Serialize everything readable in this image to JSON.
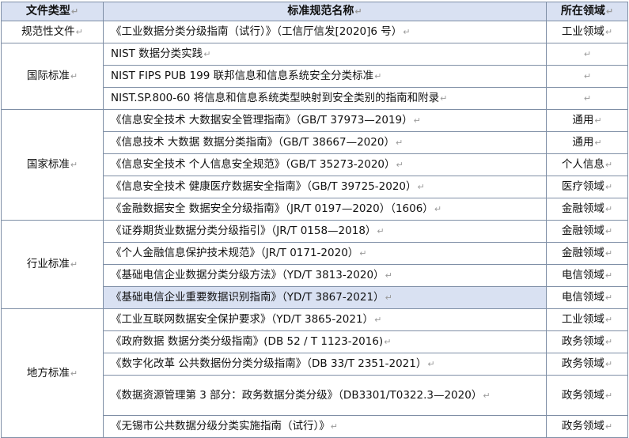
{
  "header": {
    "col_type": "文件类型",
    "col_name": "标准规范名称",
    "col_domain": "所在领域",
    "ret": "↵"
  },
  "groups": [
    {
      "type": "规范性文件",
      "rows": [
        {
          "name": "《工业数据分类分级指南（试行）》（工信厅信发[2020]6 号）",
          "domain": "工业领域"
        }
      ]
    },
    {
      "type": "国际标准",
      "rows": [
        {
          "name": "NIST 数据分类实践",
          "domain": ""
        },
        {
          "name": "NIST FIPS PUB 199 联邦信息和信息系统安全分类标准",
          "domain": ""
        },
        {
          "name": "NIST.SP.800-60 将信息和信息系统类型映射到安全类别的指南和附录",
          "domain": ""
        }
      ]
    },
    {
      "type": "国家标准",
      "rows": [
        {
          "name": "《信息安全技术 大数据安全管理指南》（GB/T 37973—2019）",
          "domain": "通用"
        },
        {
          "name": "《信息技术 大数据 数据分类指南》（GB/T 38667—2020）",
          "domain": "通用"
        },
        {
          "name": "《信息安全技术 个人信息安全规范》（GB/T 35273-2020）",
          "domain": "个人信息"
        },
        {
          "name": "《信息安全技术 健康医疗数据安全指南》（GB/T 39725-2020）",
          "domain": "医疗领域"
        },
        {
          "name": "《金融数据安全 数据安全分级指南》（JR/T 0197—2020）（1606）",
          "domain": "金融领域"
        }
      ]
    },
    {
      "type": "行业标准",
      "rows": [
        {
          "name": "《证券期货业数据分类分级指引》（JR/T 0158—2018）",
          "domain": "金融领域"
        },
        {
          "name": "《个人金融信息保护技术规范》（JR/T 0171-2020）",
          "domain": "金融领域"
        },
        {
          "name": "《基础电信企业数据分类分级方法》（YD/T 3813-2020）",
          "domain": "电信领域"
        },
        {
          "name": "《基础电信企业重要数据识别指南》（YD/T 3867-2021）",
          "domain": "电信领域"
        }
      ]
    },
    {
      "type": "地方标准",
      "rows": [
        {
          "name": "《工业互联网数据安全保护要求》（YD/T 3865-2021）",
          "domain": "工业领域"
        },
        {
          "name": "《政府数据 数据分类分级指南》(DB 52 / T 1123-2016)",
          "domain": "政务领域"
        },
        {
          "name": "《数字化改革 公共数据份分类分级指南》（DB 33/T 2351-2021）",
          "domain": "政务领域"
        },
        {
          "name": "《数据资源管理第 3 部分：政务数据分类分级》（DB3301/T0322.3—2020）",
          "domain": "政务领域"
        },
        {
          "name": "《无锡市公共数据分级分类实施指南（试行）》",
          "domain": "政务领域"
        }
      ]
    }
  ]
}
